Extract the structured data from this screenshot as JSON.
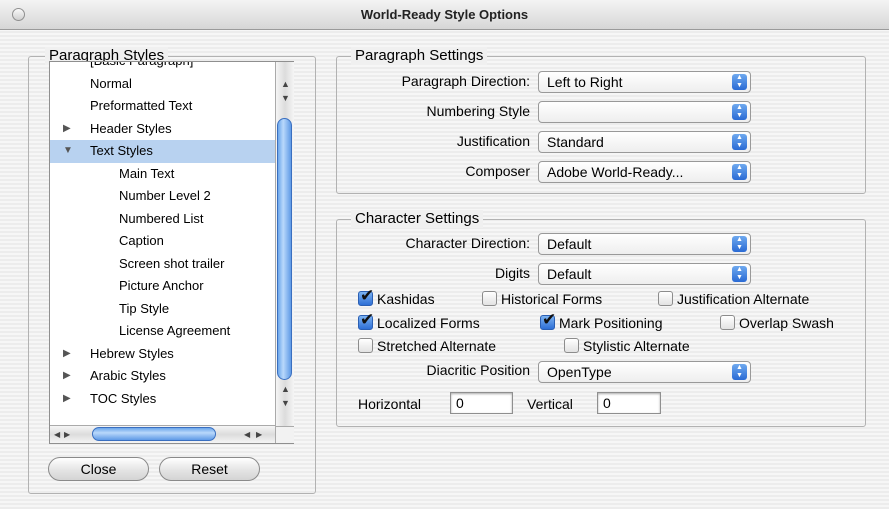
{
  "window": {
    "title": "World-Ready Style Options"
  },
  "paragraph_styles": {
    "legend": "Paragraph Styles",
    "items": [
      {
        "label": "[Basic Paragraph]",
        "indent": 0,
        "arrow": ""
      },
      {
        "label": "Normal",
        "indent": 0,
        "arrow": ""
      },
      {
        "label": "Preformatted Text",
        "indent": 0,
        "arrow": ""
      },
      {
        "label": "Header Styles",
        "indent": 0,
        "arrow": "▶"
      },
      {
        "label": "Text Styles",
        "indent": 0,
        "arrow": "▼",
        "selected": true
      },
      {
        "label": "Main Text",
        "indent": 1,
        "arrow": ""
      },
      {
        "label": "Number Level 2",
        "indent": 1,
        "arrow": ""
      },
      {
        "label": "Numbered List",
        "indent": 1,
        "arrow": ""
      },
      {
        "label": "Caption",
        "indent": 1,
        "arrow": ""
      },
      {
        "label": "Screen shot trailer",
        "indent": 1,
        "arrow": ""
      },
      {
        "label": "Picture Anchor",
        "indent": 1,
        "arrow": ""
      },
      {
        "label": "Tip Style",
        "indent": 1,
        "arrow": ""
      },
      {
        "label": "License Agreement",
        "indent": 1,
        "arrow": ""
      },
      {
        "label": "Hebrew Styles",
        "indent": 0,
        "arrow": "▶"
      },
      {
        "label": "Arabic Styles",
        "indent": 0,
        "arrow": "▶"
      },
      {
        "label": "TOC Styles",
        "indent": 0,
        "arrow": "▶"
      }
    ]
  },
  "buttons": {
    "close": "Close",
    "reset": "Reset"
  },
  "paragraph_settings": {
    "legend": "Paragraph Settings",
    "direction_label": "Paragraph Direction:",
    "direction_value": "Left to Right",
    "numbering_label": "Numbering Style",
    "numbering_value": "",
    "justification_label": "Justification",
    "justification_value": "Standard",
    "composer_label": "Composer",
    "composer_value": "Adobe World-Ready..."
  },
  "character_settings": {
    "legend": "Character Settings",
    "direction_label": "Character Direction:",
    "direction_value": "Default",
    "digits_label": "Digits",
    "digits_value": "Default",
    "checkboxes": {
      "kashidas": {
        "label": "Kashidas",
        "checked": true
      },
      "historical_forms": {
        "label": "Historical Forms",
        "checked": false
      },
      "justification_alternate": {
        "label": "Justification Alternate",
        "checked": false
      },
      "localized_forms": {
        "label": "Localized Forms",
        "checked": true
      },
      "mark_positioning": {
        "label": "Mark Positioning",
        "checked": true
      },
      "overlap_swash": {
        "label": "Overlap Swash",
        "checked": false
      },
      "stretched_alternate": {
        "label": "Stretched Alternate",
        "checked": false
      },
      "stylistic_alternate": {
        "label": "Stylistic Alternate",
        "checked": false
      }
    },
    "diacritic_label": "Diacritic Position",
    "diacritic_value": "OpenType",
    "horizontal_label": "Horizontal",
    "horizontal_value": "0",
    "vertical_label": "Vertical",
    "vertical_value": "0"
  }
}
